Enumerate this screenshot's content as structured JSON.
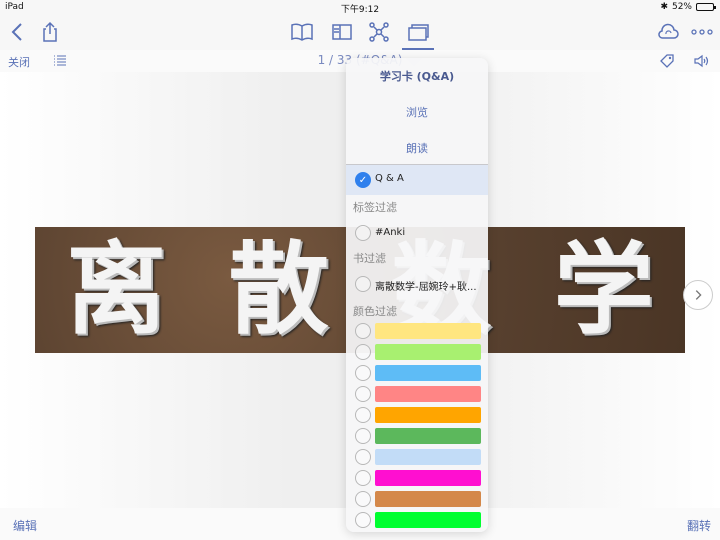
{
  "status_bar": {
    "device": "iPad",
    "time": "下午9:12",
    "battery": "52%",
    "battery_fraction": 0.52
  },
  "toolbar": {
    "icons": [
      "back-chevron-icon",
      "share-icon",
      "book-icon",
      "sidebar-view-icon",
      "mindmap-icon",
      "flashcard-icon",
      "cloud-sync-icon",
      "more-icon"
    ],
    "accent_color": "#5a72b7"
  },
  "subbar": {
    "close_label": "关闭",
    "page_info": "1 / 33 (#Q&A)"
  },
  "card": {
    "chars": [
      "离",
      "散",
      "数",
      "学"
    ]
  },
  "bottom": {
    "edit_label": "编辑",
    "flip_label": "翻转"
  },
  "popover": {
    "title": "学习卡 (Q&A)",
    "browse_label": "浏览",
    "read_aloud_label": "朗读",
    "qa_label": "Q & A",
    "tag_filter_header": "标签过滤",
    "tag_item": "#Anki",
    "book_filter_header": "书过滤",
    "book_item": "离散数学-屈婉玲+耿...",
    "color_filter_header": "颜色过滤",
    "colors": [
      "#ffe680",
      "#a8f070",
      "#5ebcf6",
      "#ff8585",
      "#ffa500",
      "#5cb85c",
      "#c2dcf7",
      "#ff0fd0",
      "#d4884a",
      "#00ff30"
    ]
  }
}
